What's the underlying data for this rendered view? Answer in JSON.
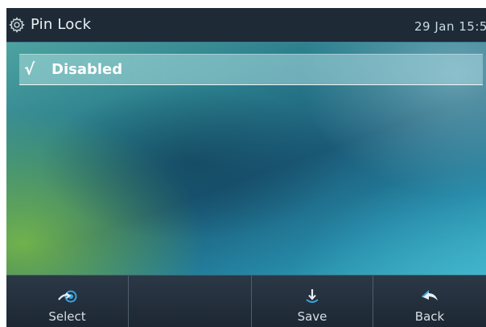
{
  "header": {
    "title": "Pin Lock",
    "datetime": "29 Jan 15:5",
    "icon": "gear-icon"
  },
  "menu": {
    "items": [
      {
        "label": "Disabled",
        "checked": true,
        "icon": "checkmark-icon",
        "check_glyph": "√"
      }
    ]
  },
  "softkeys": [
    {
      "label": "Select",
      "icon": "select-arrow-icon"
    },
    {
      "label": "",
      "icon": ""
    },
    {
      "label": "Save",
      "icon": "save-icon"
    },
    {
      "label": "Back",
      "icon": "back-arrow-icon"
    }
  ],
  "colors": {
    "title_bar_bg": "#1f2a37",
    "softkey_bar_bg": "#1d2733",
    "icon_accent": "#3aa3e0",
    "text": "#ffffff"
  }
}
